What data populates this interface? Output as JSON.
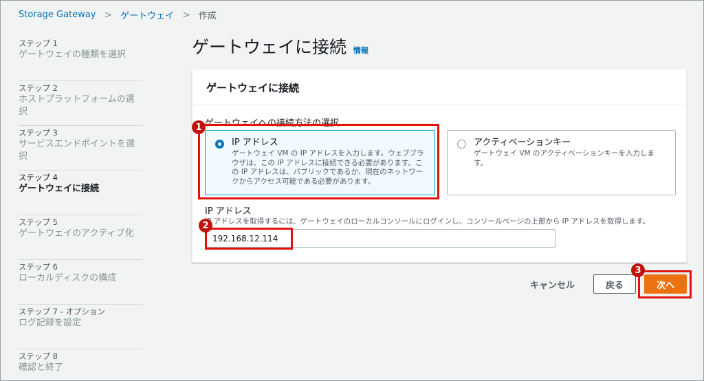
{
  "breadcrumb": {
    "items": [
      "Storage Gateway",
      "ゲートウェイ",
      "作成"
    ],
    "separator": ">"
  },
  "steps": [
    {
      "num": "ステップ 1",
      "title": "ゲートウェイの種類を選択"
    },
    {
      "num": "ステップ 2",
      "title": "ホストプラットフォームの選択"
    },
    {
      "num": "ステップ 3",
      "title": "サービスエンドポイントを選択"
    },
    {
      "num": "ステップ 4",
      "title": "ゲートウェイに接続"
    },
    {
      "num": "ステップ 5",
      "title": "ゲートウェイのアクティブ化"
    },
    {
      "num": "ステップ 6",
      "title": "ローカルディスクの構成"
    },
    {
      "num": "ステップ 7 - オプション",
      "title": "ログ記録を設定"
    },
    {
      "num": "ステップ 8",
      "title": "確認と終了"
    }
  ],
  "page": {
    "title": "ゲートウェイに接続",
    "info": "情報"
  },
  "panel": {
    "header": "ゲートウェイに接続",
    "method_label": "ゲートウェイへの接続方法の選択",
    "options": [
      {
        "title": "IP アドレス",
        "desc": "ゲートウェイ VM の IP アドレスを入力します。ウェブブラウザは、この IP アドレスに接続できる必要があります。この IP アドレスは、パブリックであるか、現在のネットワークからアクセス可能である必要があります。"
      },
      {
        "title": "アクティベーションキー",
        "desc": "ゲートウェイ VM のアクティベーションキーを入力します。"
      }
    ],
    "ip_label": "IP アドレス",
    "ip_desc": "IP アドレスを取得するには、ゲートウェイのローカルコンソールにログインし、コンソールページの上部から IP アドレスを取得します。",
    "ip_value": "192.168.12.114"
  },
  "actions": {
    "cancel": "キャンセル",
    "back": "戻る",
    "next": "次へ"
  },
  "markers": [
    "1",
    "2",
    "3"
  ],
  "colors": {
    "link": "#0073bb",
    "primary": "#ec7211",
    "highlight": "#e3120b",
    "selected_border": "#00a1c9"
  }
}
